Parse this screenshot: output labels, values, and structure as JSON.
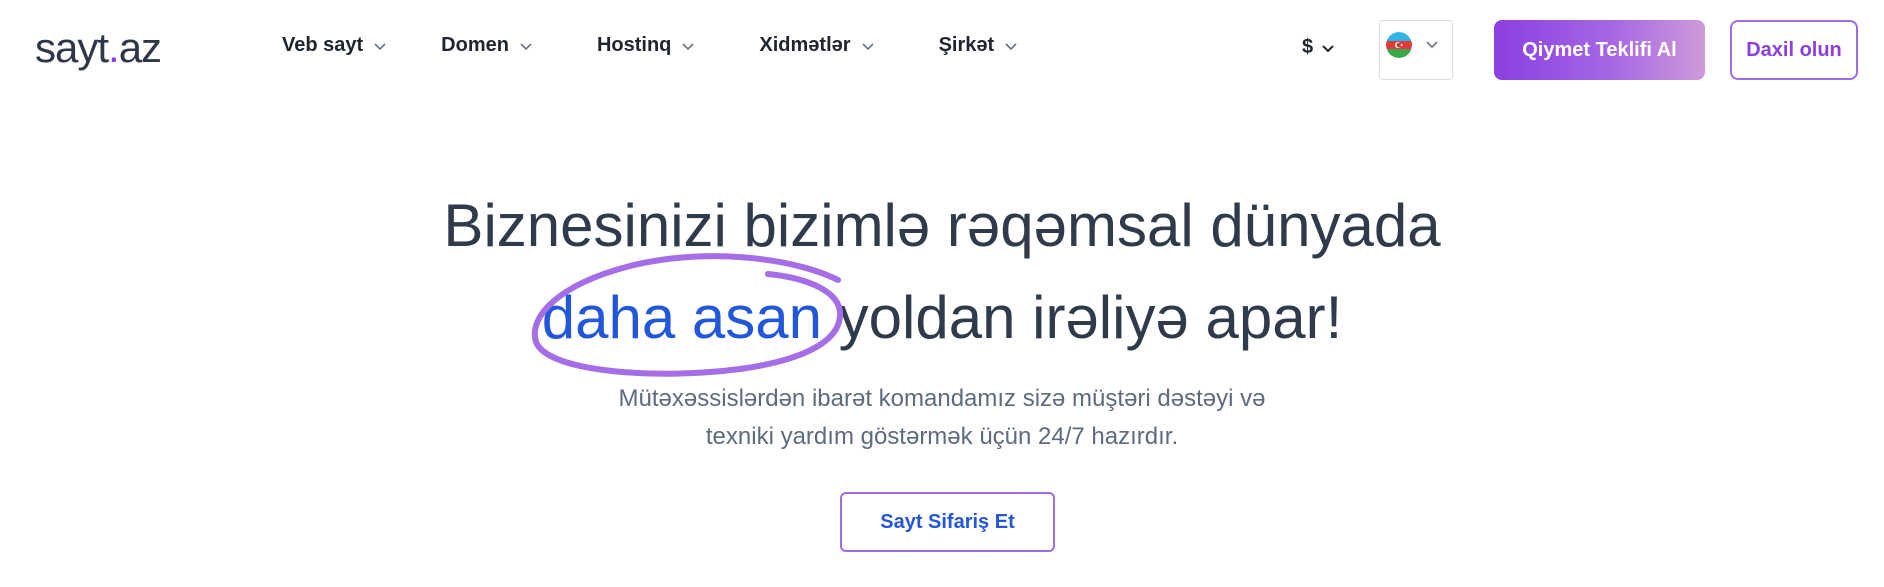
{
  "header": {
    "logo": {
      "prefix": "sayt",
      "dot": ".",
      "suffix": "az"
    },
    "nav": [
      {
        "label": "Veb sayt"
      },
      {
        "label": "Domen"
      },
      {
        "label": "Hostinq"
      },
      {
        "label": "Xidmətlər"
      },
      {
        "label": "Şirkət"
      }
    ],
    "currency": "$",
    "language_flag_icon": "azerbaijan-flag-icon",
    "quote_button": "Qiymet Teklifi Al",
    "login_button": "Daxil olun"
  },
  "hero": {
    "line1": "Biznesinizi bizimlə rəqəmsal dünyada",
    "line2_accent": "daha asan",
    "line2_rest": " yoldan irəliyə apar!",
    "subtitle_line1": "Mütəxəssislərdən ibarət komandamız sizə müştəri dəstəyi və",
    "subtitle_line2": "texniki yardım göstərmək üçün 24/7 hazırdır.",
    "cta_button": "Sayt Sifariş Et"
  },
  "colors": {
    "brand_purple": "#8b3fe0",
    "accent_blue": "#2357d9",
    "heading_text": "#2f3a4a",
    "muted_text": "#5e6b7f"
  }
}
